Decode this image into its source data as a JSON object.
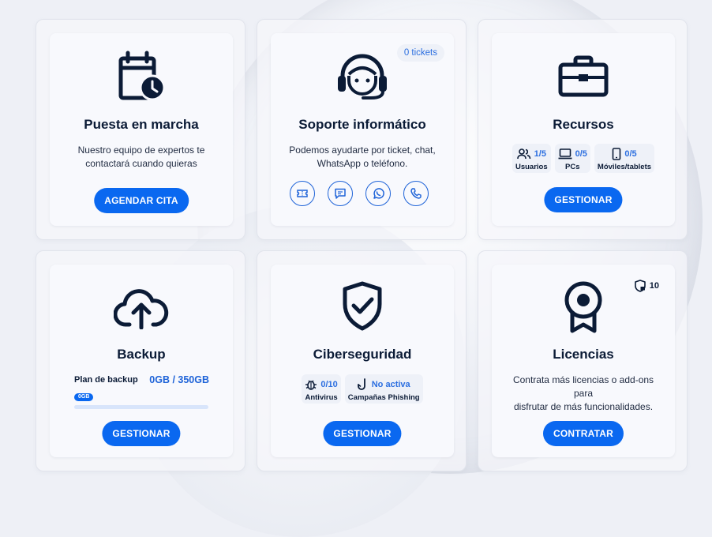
{
  "cards": {
    "puesta": {
      "title": "Puesta en marcha",
      "desc1": "Nuestro equipo de expertos te",
      "desc2": "contactará cuando quieras",
      "button": "AGENDAR CITA"
    },
    "soporte": {
      "title": "Soporte informático",
      "badge": "0 tickets",
      "desc1": "Podemos ayudarte por ticket, chat,",
      "desc2": "WhatsApp o teléfono.",
      "channels": [
        "ticket-icon",
        "chat-icon",
        "whatsapp-icon",
        "phone-icon"
      ]
    },
    "recursos": {
      "title": "Recursos",
      "stats": [
        {
          "value": "1/5",
          "label": "Usuarios",
          "icon": "users-icon"
        },
        {
          "value": "0/5",
          "label": "PCs",
          "icon": "laptop-icon"
        },
        {
          "value": "0/5",
          "label": "Móviles/tablets",
          "icon": "mobile-icon"
        }
      ],
      "button": "GESTIONAR"
    },
    "backup": {
      "title": "Backup",
      "plan_label": "Plan de backup",
      "plan_value": "0GB / 350GB",
      "used_pill": "0GB",
      "used_fraction": 0,
      "button": "GESTIONAR"
    },
    "ciber": {
      "title": "Ciberseguridad",
      "stats": [
        {
          "value": "0/10",
          "label": "Antivirus",
          "icon": "bug-icon"
        },
        {
          "value": "No activa",
          "label": "Campañas Phishing",
          "icon": "hook-icon"
        }
      ],
      "button": "GESTIONAR"
    },
    "licencias": {
      "title": "Licencias",
      "badge_value": "10",
      "desc1": "Contrata más licencias o add-ons para",
      "desc2": "disfrutar de más funcionalidades.",
      "button": "CONTRATAR"
    }
  },
  "colors": {
    "accent": "#0a68f0",
    "dark": "#0b1b36",
    "stat_value": "#2c6fe0"
  }
}
